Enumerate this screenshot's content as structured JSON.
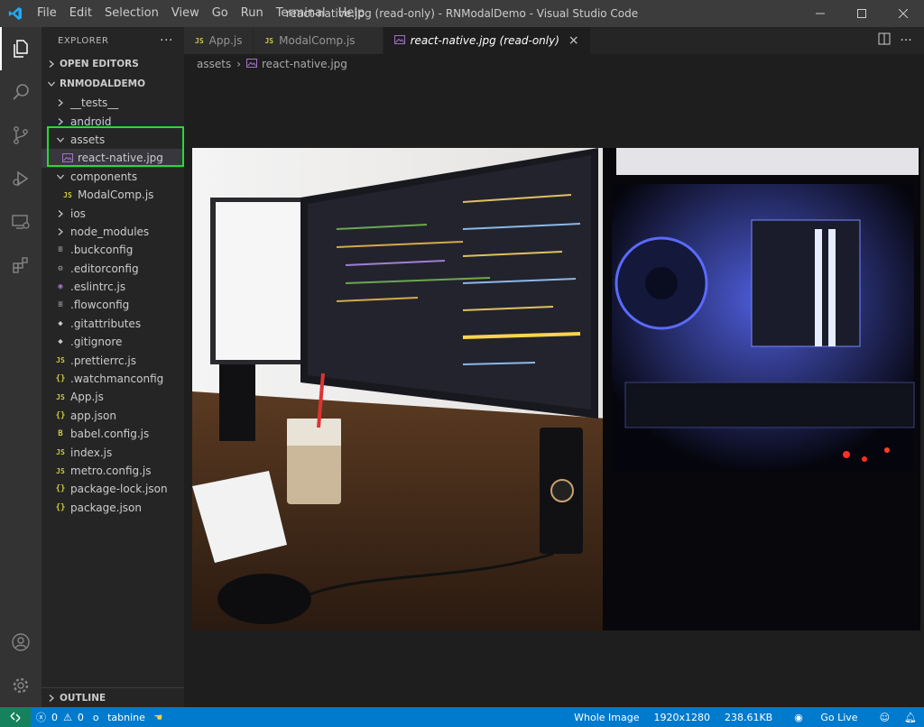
{
  "window": {
    "title": "react-native.jpg (read-only) - RNModalDemo - Visual Studio Code",
    "menu": [
      "File",
      "Edit",
      "Selection",
      "View",
      "Go",
      "Run",
      "Terminal",
      "Help"
    ]
  },
  "sidebar": {
    "header": "EXPLORER",
    "open_editors": "OPEN EDITORS",
    "project": "RNMODALDEMO",
    "outline": "OUTLINE",
    "tree": [
      {
        "label": "__tests__",
        "type": "folder",
        "state": "collapsed",
        "indent": 1
      },
      {
        "label": "android",
        "type": "folder",
        "state": "collapsed",
        "indent": 1
      },
      {
        "label": "assets",
        "type": "folder",
        "state": "expanded",
        "indent": 1
      },
      {
        "label": "react-native.jpg",
        "type": "image",
        "indent": 2,
        "selected": true
      },
      {
        "label": "components",
        "type": "folder",
        "state": "expanded",
        "indent": 1
      },
      {
        "label": "ModalComp.js",
        "type": "js",
        "indent": 2
      },
      {
        "label": "ios",
        "type": "folder",
        "state": "collapsed",
        "indent": 1
      },
      {
        "label": "node_modules",
        "type": "folder",
        "state": "collapsed",
        "indent": 1
      },
      {
        "label": ".buckconfig",
        "type": "lines",
        "indent": 1
      },
      {
        "label": ".editorconfig",
        "type": "gear",
        "indent": 1
      },
      {
        "label": ".eslintrc.js",
        "type": "eslint",
        "indent": 1
      },
      {
        "label": ".flowconfig",
        "type": "lines",
        "indent": 1
      },
      {
        "label": ".gitattributes",
        "type": "git",
        "indent": 1
      },
      {
        "label": ".gitignore",
        "type": "git",
        "indent": 1
      },
      {
        "label": ".prettierrc.js",
        "type": "js",
        "indent": 1
      },
      {
        "label": ".watchmanconfig",
        "type": "json",
        "indent": 1
      },
      {
        "label": "App.js",
        "type": "js",
        "indent": 1
      },
      {
        "label": "app.json",
        "type": "json",
        "indent": 1
      },
      {
        "label": "babel.config.js",
        "type": "babel",
        "indent": 1
      },
      {
        "label": "index.js",
        "type": "js",
        "indent": 1
      },
      {
        "label": "metro.config.js",
        "type": "js",
        "indent": 1
      },
      {
        "label": "package-lock.json",
        "type": "json",
        "indent": 1
      },
      {
        "label": "package.json",
        "type": "json",
        "indent": 1
      }
    ]
  },
  "tabs": [
    {
      "label": "App.js",
      "icon": "JS",
      "active": false
    },
    {
      "label": "ModalComp.js",
      "icon": "JS",
      "active": false
    },
    {
      "label": "react-native.jpg (read-only)",
      "icon": "image",
      "active": true
    }
  ],
  "breadcrumb": {
    "folder": "assets",
    "file": "react-native.jpg"
  },
  "statusbar": {
    "errors": "0",
    "warnings": "0",
    "tabnine": "tabnine",
    "whole_image": "Whole Image",
    "dimensions": "1920x1280",
    "size": "238.61KB",
    "go_live": "Go Live"
  },
  "colors": {
    "statusbar": "#007acc",
    "highlight": "#27d936",
    "remote": "#16825d"
  }
}
